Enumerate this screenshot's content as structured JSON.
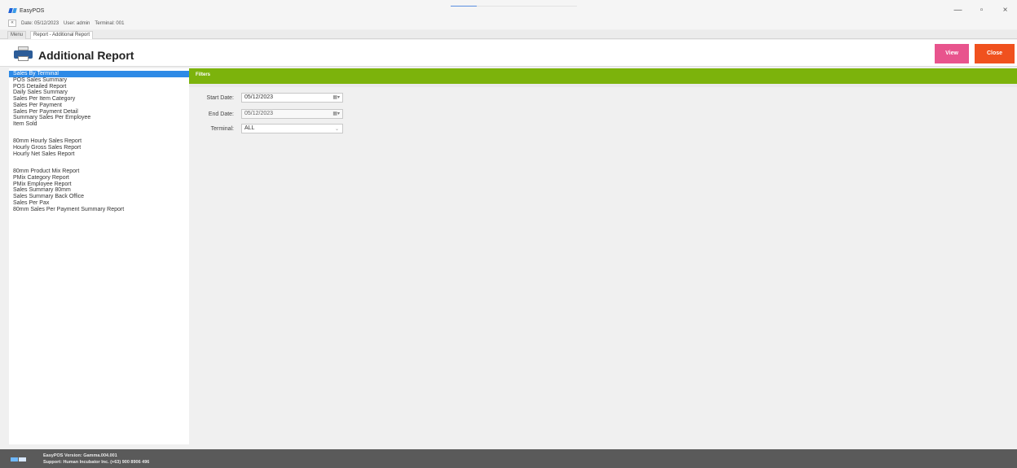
{
  "app": {
    "name": "EasyPOS",
    "date_label": "Date: 05/12/2023",
    "user_label": "User: admin",
    "terminal_label": "Terminal: 001",
    "back_glyph": "«"
  },
  "window_controls": {
    "minimize": "—",
    "restore": "▫",
    "close": "×"
  },
  "tabs": [
    {
      "label": "Menu",
      "active": false
    },
    {
      "label": "Report - Additional Report",
      "active": true
    }
  ],
  "header": {
    "icon": "printer-icon",
    "title": "Additional Report",
    "view_label": "View",
    "close_label": "Close",
    "colors": {
      "view": "#e8548d",
      "close": "#f0511e"
    }
  },
  "reports": [
    "Sales By Terminal",
    "POS Sales Summary",
    "POS Detailed Report",
    "Daily Sales Summary",
    "Sales Per Item Category",
    "Sales Per Payment",
    "Sales Per Payment Detail",
    "Summary Sales Per Employee",
    "Item Sold",
    "",
    "80mm Hourly Sales Report",
    "Hourly Gross Sales Report",
    "Hourly Net Sales Report",
    "",
    "80mm Product Mix Report",
    "PMix Category Report",
    "PMix Employee Report",
    "Sales Summary 80mm",
    "Sales Summary Back Office",
    "Sales Per Pax",
    "80mm Sales Per Payment Summary Report"
  ],
  "selected_report": "Sales By Terminal",
  "filters": {
    "header": "Filters",
    "header_color": "#7cb30c",
    "start_date_label": "Start Date:",
    "start_date_value": "05/12/2023",
    "end_date_label": "End Date:",
    "end_date_value": "05/12/2023",
    "terminal_label": "Terminal:",
    "terminal_value": "ALL"
  },
  "footer": {
    "version": "EasyPOS Version: Gamma.004.001",
    "support": "Support: Human Incubator Inc. (+63) 900 8906 496"
  }
}
